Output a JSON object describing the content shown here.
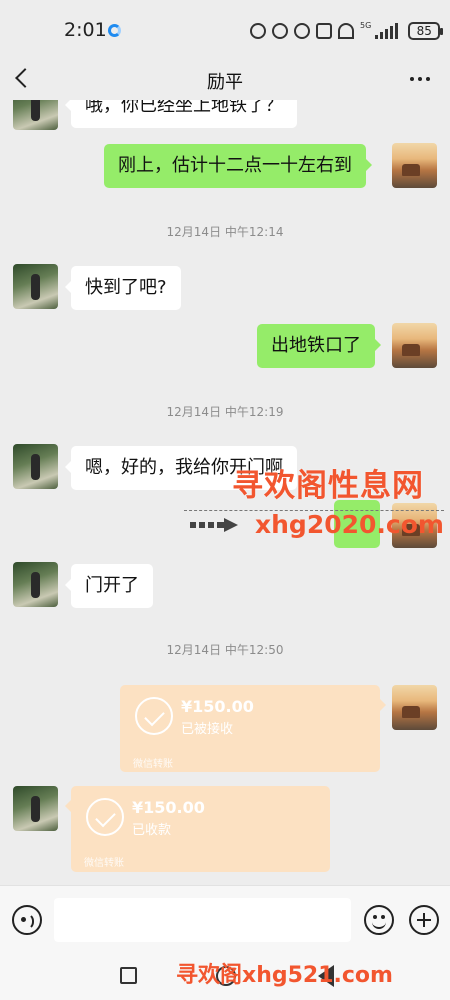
{
  "status_bar": {
    "time": "2:01",
    "network_label": "5G",
    "battery": "85"
  },
  "header": {
    "title": "励平"
  },
  "messages": [
    {
      "type": "text",
      "side": "in",
      "text": "哦，你已经坐上地铁了？"
    },
    {
      "type": "text",
      "side": "out",
      "text": "刚上，估计十二点一十左右到"
    },
    {
      "type": "timestamp",
      "text": "12月14日 中午12:14"
    },
    {
      "type": "text",
      "side": "in",
      "text": "快到了吧?"
    },
    {
      "type": "text",
      "side": "out",
      "text": "出地铁口了"
    },
    {
      "type": "timestamp",
      "text": "12月14日 中午12:19"
    },
    {
      "type": "text",
      "side": "in",
      "text": "嗯，好的，我给你开门啊"
    },
    {
      "type": "text",
      "side": "in",
      "text": "门开了"
    },
    {
      "type": "timestamp",
      "text": "12月14日 中午12:50"
    },
    {
      "type": "transfer",
      "side": "out",
      "amount": "¥150.00",
      "status": "已被接收",
      "label": "微信转账"
    },
    {
      "type": "transfer",
      "side": "in",
      "amount": "¥150.00",
      "status": "已收款",
      "label": "微信转账"
    }
  ],
  "watermarks": {
    "top_cn": "寻欢阁性息网",
    "top_url": "xhg2020.com",
    "bottom": "寻欢阁xhg521.com"
  },
  "input_bar": {
    "placeholder": ""
  },
  "icons": {
    "back": "back-icon",
    "more": "more-icon",
    "voice": "voice-icon",
    "emoji": "emoji-icon",
    "plus": "plus-icon"
  },
  "colors": {
    "background": "#ededed",
    "outgoing_bubble": "#95ec69",
    "incoming_bubble": "#ffffff",
    "transfer_card": "#fce1c2",
    "watermark": "#f2562f"
  }
}
